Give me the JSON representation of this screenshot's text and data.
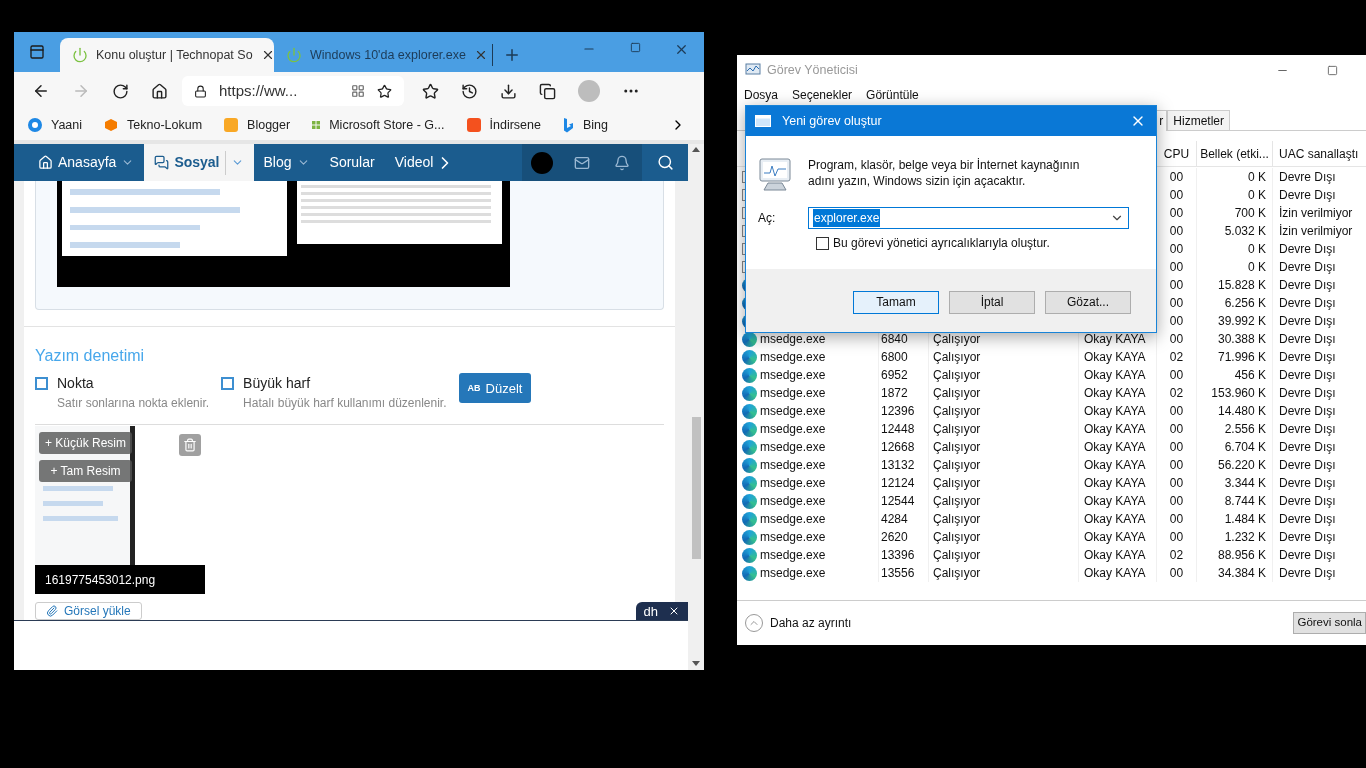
{
  "browser": {
    "tabs": [
      {
        "title": "Konu oluştur | Technopat So",
        "selected": true
      },
      {
        "title": "Windows 10'da explorer.exe",
        "selected": false
      }
    ],
    "address": "https://ww...",
    "bookmarks": [
      {
        "label": "Yaani",
        "kind": "ring",
        "color": "#1e88e5"
      },
      {
        "label": "Tekno-Lokum",
        "kind": "cube",
        "color": "#f57c00"
      },
      {
        "label": "Blogger",
        "kind": "square",
        "color": "#f9a825"
      },
      {
        "label": "Microsoft Store - G...",
        "kind": "grid",
        "color": "#7cb342"
      },
      {
        "label": "İndirsene",
        "kind": "square",
        "color": "#f4511e"
      },
      {
        "label": "Bing",
        "kind": "bing",
        "color": "#1e88e5"
      }
    ],
    "site_nav": [
      {
        "label": "Anasayfa",
        "has_menu": true,
        "selected": false
      },
      {
        "label": "Sosyal",
        "has_menu": true,
        "selected": true
      },
      {
        "label": "Blog",
        "has_menu": true,
        "selected": false
      },
      {
        "label": "Sorular",
        "has_menu": false,
        "selected": false
      },
      {
        "label": "Videol",
        "has_menu": false,
        "selected": false
      }
    ],
    "spellcheck": {
      "heading": "Yazım denetimi",
      "options": [
        {
          "label": "Nokta",
          "hint": "Satır sonlarına nokta eklenir.",
          "checked": false
        },
        {
          "label": "Büyük harf",
          "hint": "Hatalı büyük harf kullanımı düzenlenir.",
          "checked": false
        }
      ],
      "fix_badge": "AB",
      "fix_button": "Düzelt"
    },
    "attachment": {
      "filename": "1619775453012.png",
      "actions": [
        "+ Küçük Resim",
        "+ Tam Resim"
      ]
    },
    "upload_button": "Görsel yükle",
    "ad_badge": "dh"
  },
  "task_manager": {
    "title": "Görev Yöneticisi",
    "menu": [
      "Dosya",
      "Seçenekler",
      "Görüntüle"
    ],
    "tabs": [
      {
        "label": "r",
        "selected": true
      },
      {
        "label": "Hizmetler",
        "selected": false
      }
    ],
    "columns": {
      "cpu": "CPU",
      "memory": "Bellek (etki...",
      "uac": "UAC sanallaştı"
    },
    "rows": [
      {
        "kind": "service",
        "cpu": "00",
        "memory": "0 K",
        "uac": "Devre Dışı"
      },
      {
        "kind": "service",
        "cpu": "00",
        "memory": "0 K",
        "uac": "Devre Dışı"
      },
      {
        "kind": "service",
        "cpu": "00",
        "memory": "700 K",
        "uac": "İzin verilmiyor"
      },
      {
        "kind": "service",
        "cpu": "00",
        "memory": "5.032 K",
        "uac": "İzin verilmiyor"
      },
      {
        "kind": "service",
        "cpu": "00",
        "memory": "0 K",
        "uac": "Devre Dışı"
      },
      {
        "kind": "service",
        "cpu": "00",
        "memory": "0 K",
        "uac": "Devre Dışı"
      },
      {
        "kind": "edge",
        "cpu": "00",
        "memory": "15.828 K",
        "uac": "Devre Dışı"
      },
      {
        "kind": "edge",
        "cpu": "00",
        "memory": "6.256 K",
        "uac": "Devre Dışı"
      },
      {
        "kind": "edge",
        "cpu": "00",
        "memory": "39.992 K",
        "uac": "Devre Dışı"
      },
      {
        "kind": "edge",
        "name": "msedge.exe",
        "pid": "6840",
        "status": "Çalışıyor",
        "user": "Okay KAYA",
        "cpu": "00",
        "memory": "30.388 K",
        "uac": "Devre Dışı"
      },
      {
        "kind": "edge",
        "name": "msedge.exe",
        "pid": "6800",
        "status": "Çalışıyor",
        "user": "Okay KAYA",
        "cpu": "02",
        "memory": "71.996 K",
        "uac": "Devre Dışı"
      },
      {
        "kind": "edge",
        "name": "msedge.exe",
        "pid": "6952",
        "status": "Çalışıyor",
        "user": "Okay KAYA",
        "cpu": "00",
        "memory": "456 K",
        "uac": "Devre Dışı"
      },
      {
        "kind": "edge",
        "name": "msedge.exe",
        "pid": "1872",
        "status": "Çalışıyor",
        "user": "Okay KAYA",
        "cpu": "02",
        "memory": "153.960 K",
        "uac": "Devre Dışı"
      },
      {
        "kind": "edge",
        "name": "msedge.exe",
        "pid": "12396",
        "status": "Çalışıyor",
        "user": "Okay KAYA",
        "cpu": "00",
        "memory": "14.480 K",
        "uac": "Devre Dışı"
      },
      {
        "kind": "edge",
        "name": "msedge.exe",
        "pid": "12448",
        "status": "Çalışıyor",
        "user": "Okay KAYA",
        "cpu": "00",
        "memory": "2.556 K",
        "uac": "Devre Dışı"
      },
      {
        "kind": "edge",
        "name": "msedge.exe",
        "pid": "12668",
        "status": "Çalışıyor",
        "user": "Okay KAYA",
        "cpu": "00",
        "memory": "6.704 K",
        "uac": "Devre Dışı"
      },
      {
        "kind": "edge",
        "name": "msedge.exe",
        "pid": "13132",
        "status": "Çalışıyor",
        "user": "Okay KAYA",
        "cpu": "00",
        "memory": "56.220 K",
        "uac": "Devre Dışı"
      },
      {
        "kind": "edge",
        "name": "msedge.exe",
        "pid": "12124",
        "status": "Çalışıyor",
        "user": "Okay KAYA",
        "cpu": "00",
        "memory": "3.344 K",
        "uac": "Devre Dışı"
      },
      {
        "kind": "edge",
        "name": "msedge.exe",
        "pid": "12544",
        "status": "Çalışıyor",
        "user": "Okay KAYA",
        "cpu": "00",
        "memory": "8.744 K",
        "uac": "Devre Dışı"
      },
      {
        "kind": "edge",
        "name": "msedge.exe",
        "pid": "4284",
        "status": "Çalışıyor",
        "user": "Okay KAYA",
        "cpu": "00",
        "memory": "1.484 K",
        "uac": "Devre Dışı"
      },
      {
        "kind": "edge",
        "name": "msedge.exe",
        "pid": "2620",
        "status": "Çalışıyor",
        "user": "Okay KAYA",
        "cpu": "00",
        "memory": "1.232 K",
        "uac": "Devre Dışı"
      },
      {
        "kind": "edge",
        "name": "msedge.exe",
        "pid": "13396",
        "status": "Çalışıyor",
        "user": "Okay KAYA",
        "cpu": "02",
        "memory": "88.956 K",
        "uac": "Devre Dışı"
      },
      {
        "kind": "edge",
        "name": "msedge.exe",
        "pid": "13556",
        "status": "Çalışıyor",
        "user": "Okay KAYA",
        "cpu": "00",
        "memory": "34.384 K",
        "uac": "Devre Dışı"
      }
    ],
    "less_details": "Daha az ayrıntı",
    "end_task_button": "Görevi sonla"
  },
  "dialog": {
    "title": "Yeni görev oluştur",
    "message": "Program, klasör, belge veya bir İnternet kaynağının adını yazın, Windows sizin için açacaktır.",
    "open_label": "Aç:",
    "open_value": "explorer.exe",
    "value_selected": true,
    "admin_checkbox": {
      "label": "Bu görevi yönetici ayrıcalıklarıyla oluştur.",
      "checked": false
    },
    "buttons": [
      {
        "label": "Tamam",
        "default": true
      },
      {
        "label": "İptal",
        "default": false
      },
      {
        "label": "Gözat...",
        "default": false
      }
    ]
  }
}
